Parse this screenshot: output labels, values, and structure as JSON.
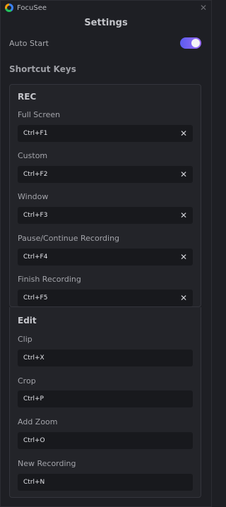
{
  "app": {
    "title": "FocuSee"
  },
  "page": {
    "title": "Settings"
  },
  "auto_start": {
    "label": "Auto Start",
    "enabled": true
  },
  "shortcuts": {
    "title": "Shortcut Keys",
    "rec": {
      "title": "REC",
      "items": [
        {
          "label": "Full Screen",
          "value": "Ctrl+F1"
        },
        {
          "label": "Custom",
          "value": "Ctrl+F2"
        },
        {
          "label": "Window",
          "value": "Ctrl+F3"
        },
        {
          "label": "Pause/Continue Recording",
          "value": "Ctrl+F4"
        },
        {
          "label": "Finish Recording",
          "value": "Ctrl+F5"
        }
      ]
    },
    "edit": {
      "title": "Edit",
      "items": [
        {
          "label": "Clip",
          "value": "Ctrl+X"
        },
        {
          "label": "Crop",
          "value": "Ctrl+P"
        },
        {
          "label": "Add Zoom",
          "value": "Ctrl+O"
        },
        {
          "label": "New Recording",
          "value": "Ctrl+N"
        }
      ]
    }
  },
  "icons": {
    "close": "close-icon",
    "clear": "clear-icon"
  },
  "colors": {
    "toggle_start": "#5b5cf0",
    "toggle_end": "#9b6cf5",
    "background": "#1e1f24"
  }
}
